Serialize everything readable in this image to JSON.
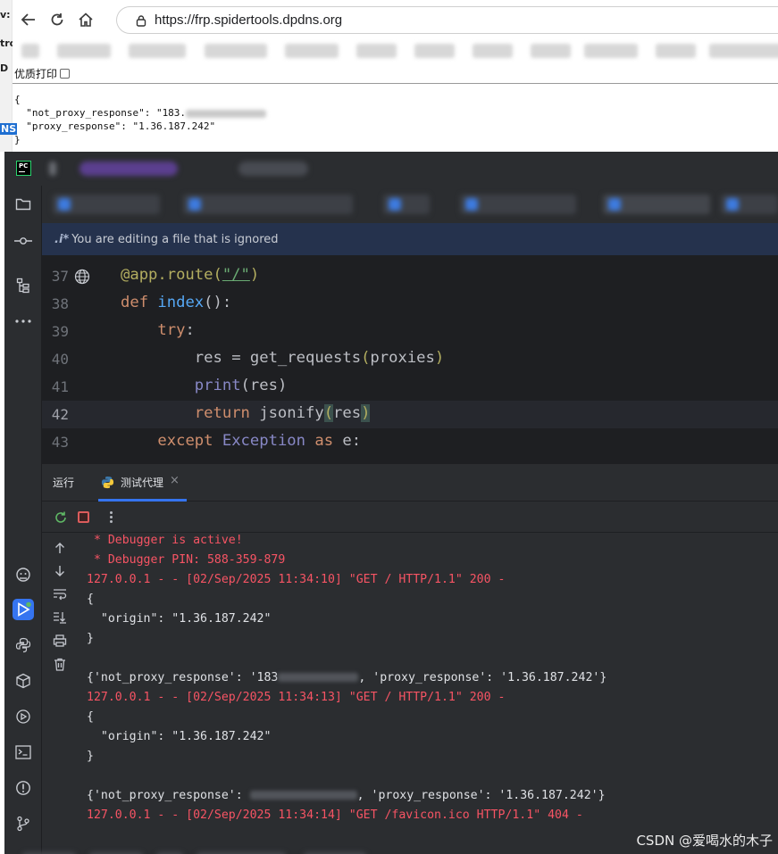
{
  "browser": {
    "url": "https://frp.spidertools.dpdns.org",
    "left_clip_text": [
      "v:",
      "tro",
      "D",
      "NS",
      "+"
    ],
    "pretty_print_label": "优质打印",
    "json_lines": {
      "open": "{",
      "l1_key": "  \"not_proxy_response\": \"183.",
      "l2": "  \"proxy_response\": \"1.36.187.242\"",
      "close": "}"
    }
  },
  "ide": {
    "banner": {
      "icon_text": ".i*",
      "message": "You are editing a file that is ignored"
    },
    "editor": {
      "line_numbers": [
        "37",
        "38",
        "39",
        "40",
        "41",
        "42",
        "43"
      ],
      "lines": {
        "l37_prefix": "@app.route(",
        "l37_str": "\"/\"",
        "l37_suffix": ")",
        "l38_def": "def",
        "l38_name": "index",
        "l38_rest": "():",
        "l39_kw": "try",
        "l39_rest": ":",
        "l40_a": "res = get_requests",
        "l40_b": "(",
        "l40_c": "proxies",
        "l40_d": ")",
        "l41_fn": "print",
        "l41_rest": "(res)",
        "l42_kw": "return",
        "l42_a": " jsonify",
        "l42_b": "(",
        "l42_c": "res",
        "l42_d": ")",
        "l43_kw": "except",
        "l43_cls": "Exception",
        "l43_as": "as",
        "l43_rest": " e:"
      }
    },
    "run_panel": {
      "tab_run": "运行",
      "tab_config": "测试代理",
      "close_glyph": "×",
      "console_lines": [
        " * Debugger is active!",
        " * Debugger PIN: 588-359-879",
        "127.0.0.1 - - [02/Sep/2025 11:34:10] \"GET / HTTP/1.1\" 200 -",
        "{",
        "  \"origin\": \"1.36.187.242\"",
        "}",
        "",
        "{'not_proxy_response': '183",
        ", 'proxy_response': '1.36.187.242'}",
        "127.0.0.1 - - [02/Sep/2025 11:34:13] \"GET / HTTP/1.1\" 200 -",
        "{",
        "  \"origin\": \"1.36.187.242\"",
        "}",
        "",
        "{'not_proxy_response': ",
        ", 'proxy_response': '1.36.187.242'}",
        "127.0.0.1 - - [02/Sep/2025 11:34:14] \"GET /favicon.ico HTTP/1.1\" 404 -"
      ]
    },
    "watermark": "CSDN @爱喝水的木子"
  },
  "colors": {
    "ide_bg": "#2b2d30",
    "editor_bg": "#1e1f22",
    "banner_bg": "#25324d",
    "accent": "#3574f0",
    "error_red": "#f75464"
  }
}
